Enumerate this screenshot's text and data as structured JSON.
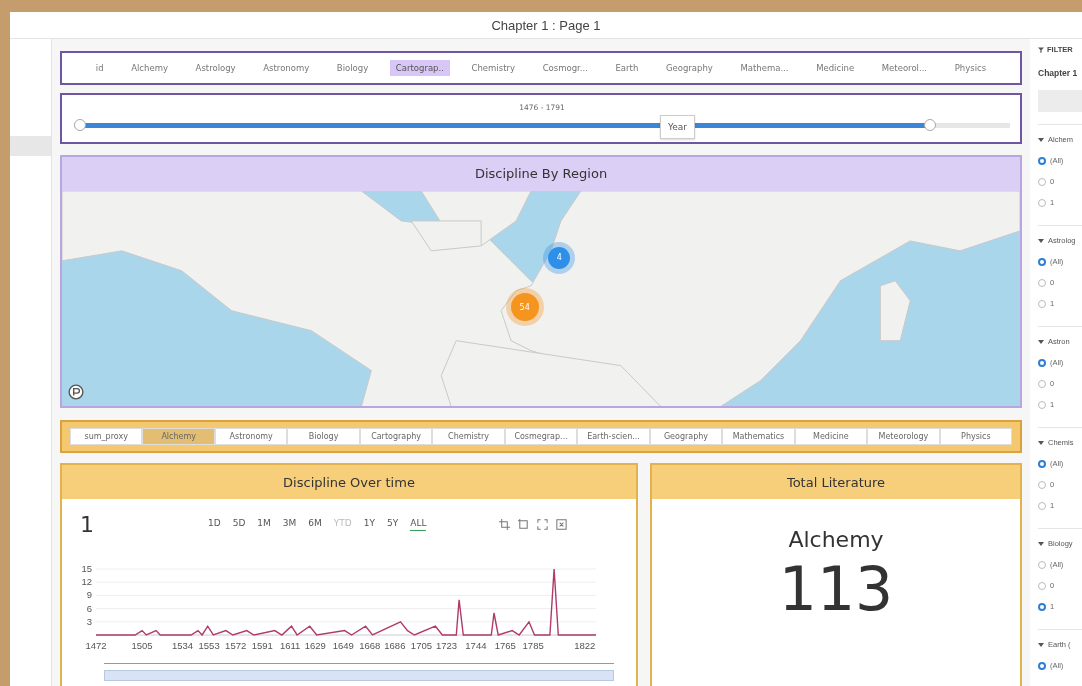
{
  "window": {
    "title": "Chapter 1 : Page 1"
  },
  "discipline_tabs": [
    {
      "label": "id",
      "selected": false
    },
    {
      "label": "Alchemy",
      "selected": false
    },
    {
      "label": "Astrology",
      "selected": false
    },
    {
      "label": "Astronomy",
      "selected": false
    },
    {
      "label": "Biology",
      "selected": false
    },
    {
      "label": "Cartograp..",
      "selected": true
    },
    {
      "label": "Chemistry",
      "selected": false
    },
    {
      "label": "Cosmogr...",
      "selected": false
    },
    {
      "label": "Earth",
      "selected": false
    },
    {
      "label": "Geography",
      "selected": false
    },
    {
      "label": "Mathema...",
      "selected": false
    },
    {
      "label": "Medicine",
      "selected": false
    },
    {
      "label": "Meteorol...",
      "selected": false
    },
    {
      "label": "Physics",
      "selected": false
    }
  ],
  "year_slider": {
    "reading": "1476 - 1791",
    "level": 0.92,
    "tooltip": "Year"
  },
  "map_card": {
    "title": "Discipline By Region",
    "clusters": [
      {
        "count": "4",
        "color": "#2d8fe8"
      },
      {
        "count": "54",
        "color": "#f5941f"
      }
    ]
  },
  "measure_tabs": [
    {
      "label": "sum_proxy",
      "selected": false
    },
    {
      "label": "Alchemy",
      "selected": true
    },
    {
      "label": "Astronomy",
      "selected": false
    },
    {
      "label": "Biology",
      "selected": false
    },
    {
      "label": "Cartography",
      "selected": false
    },
    {
      "label": "Chemistry",
      "selected": false
    },
    {
      "label": "Cosmegrap...",
      "selected": false
    },
    {
      "label": "Earth-scien...",
      "selected": false
    },
    {
      "label": "Geography",
      "selected": false
    },
    {
      "label": "Mathematics",
      "selected": false
    },
    {
      "label": "Medicine",
      "selected": false
    },
    {
      "label": "Meteorology",
      "selected": false
    },
    {
      "label": "Physics",
      "selected": false
    }
  ],
  "time_card": {
    "title": "Discipline Over time",
    "value": "1",
    "ranges": [
      {
        "label": "1D",
        "selected": false,
        "disabled": false
      },
      {
        "label": "5D",
        "selected": false,
        "disabled": false
      },
      {
        "label": "1M",
        "selected": false,
        "disabled": false
      },
      {
        "label": "3M",
        "selected": false,
        "disabled": false
      },
      {
        "label": "6M",
        "selected": false,
        "disabled": false
      },
      {
        "label": "YTD",
        "selected": false,
        "disabled": true
      },
      {
        "label": "1Y",
        "selected": false,
        "disabled": false
      },
      {
        "label": "5Y",
        "selected": false,
        "disabled": false
      },
      {
        "label": "ALL",
        "selected": true,
        "disabled": false
      }
    ],
    "chart_data": {
      "type": "line",
      "xlim": [
        1472,
        1830
      ],
      "grid": true,
      "ylim": [
        0,
        15
      ],
      "yticks": [
        3,
        6,
        9,
        12,
        15
      ],
      "xticks": [
        1472,
        1505,
        1534,
        1553,
        1572,
        1591,
        1611,
        1629,
        1649,
        1668,
        1686,
        1705,
        1723,
        1744,
        1765,
        1785,
        1822
      ],
      "x": [
        1472,
        1500,
        1505,
        1508,
        1515,
        1518,
        1540,
        1545,
        1548,
        1552,
        1556,
        1565,
        1570,
        1580,
        1585,
        1600,
        1605,
        1612,
        1616,
        1625,
        1630,
        1650,
        1655,
        1665,
        1670,
        1690,
        1695,
        1700,
        1715,
        1720,
        1730,
        1732,
        1735,
        1755,
        1757,
        1760,
        1770,
        1775,
        1782,
        1786,
        1797,
        1800,
        1803,
        1830
      ],
      "series": [
        {
          "color": "#b03a6a",
          "values": [
            0,
            0,
            1,
            0,
            1,
            0,
            0,
            1,
            0,
            2,
            0,
            1,
            0,
            1,
            0,
            1,
            0,
            2,
            0,
            2,
            0,
            1,
            0,
            2,
            0,
            3,
            1,
            0,
            2,
            0,
            0,
            8,
            0,
            0,
            5,
            0,
            1,
            0,
            3,
            0,
            0,
            15,
            0,
            0
          ]
        }
      ]
    }
  },
  "total_card": {
    "title": "Total Literature",
    "label": "Alchemy",
    "value": "113"
  },
  "filters": {
    "title": "FILTER",
    "chapter_label": "Chapter 1",
    "groups": [
      {
        "label": "Alchem",
        "expanded": true,
        "options": [
          {
            "label": "(All)",
            "selected": true
          },
          {
            "label": "0",
            "selected": false
          },
          {
            "label": "1",
            "selected": false
          }
        ]
      },
      {
        "label": "Astrolog",
        "expanded": true,
        "options": [
          {
            "label": "(All)",
            "selected": true
          },
          {
            "label": "0",
            "selected": false
          },
          {
            "label": "1",
            "selected": false
          }
        ]
      },
      {
        "label": "Astron",
        "expanded": true,
        "options": [
          {
            "label": "(All)",
            "selected": true
          },
          {
            "label": "0",
            "selected": false
          },
          {
            "label": "1",
            "selected": false
          }
        ]
      },
      {
        "label": "Chemis",
        "expanded": true,
        "options": [
          {
            "label": "(All)",
            "selected": true
          },
          {
            "label": "0",
            "selected": false
          },
          {
            "label": "1",
            "selected": false
          }
        ]
      },
      {
        "label": "Biology",
        "expanded": true,
        "options": [
          {
            "label": "(All)",
            "selected": false
          },
          {
            "label": "0",
            "selected": false
          },
          {
            "label": "1",
            "selected": true
          }
        ]
      },
      {
        "label": "Earth (",
        "expanded": true,
        "options": [
          {
            "label": "(All)",
            "selected": true
          }
        ]
      }
    ]
  }
}
